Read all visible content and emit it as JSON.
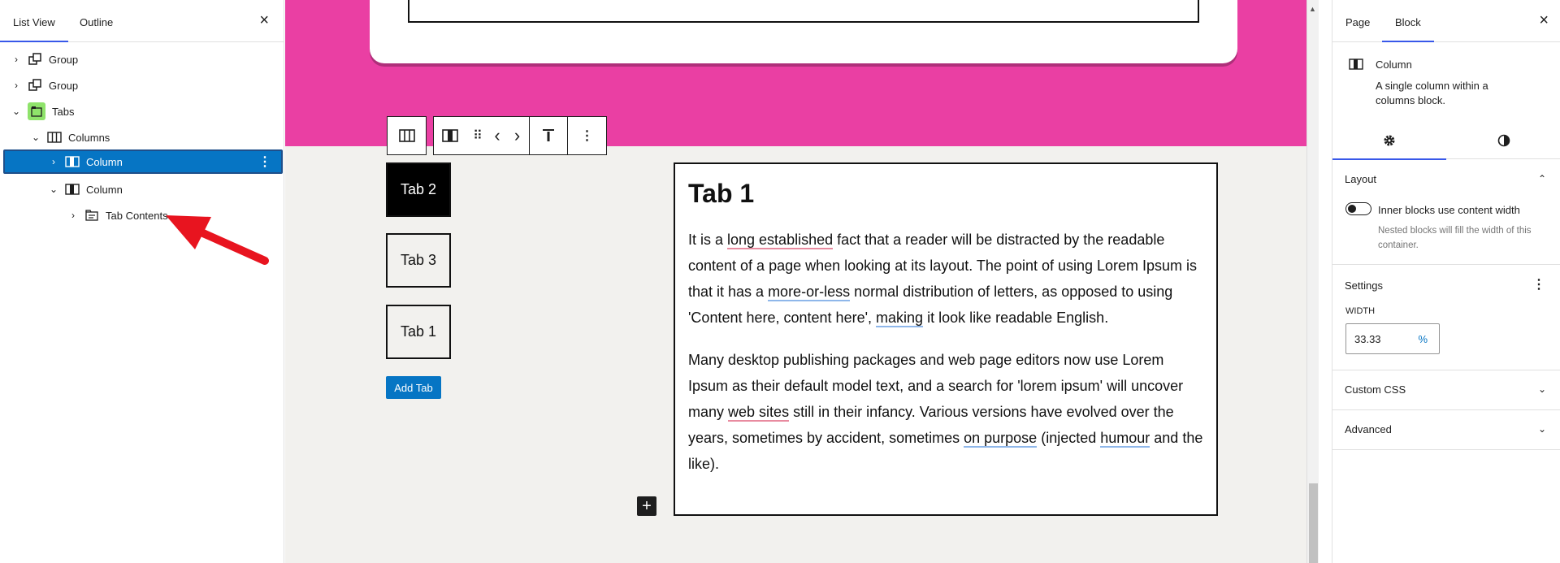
{
  "listview": {
    "tabs": [
      "List View",
      "Outline"
    ],
    "close": "×",
    "items": [
      {
        "label": "Group",
        "chevron": "›"
      },
      {
        "label": "Group",
        "chevron": "›"
      },
      {
        "label": "Tabs",
        "chevron": "⌄"
      },
      {
        "label": "Columns",
        "chevron": "⌄"
      },
      {
        "label": "Column",
        "chevron": "›"
      },
      {
        "label": "Column",
        "chevron": "⌄"
      },
      {
        "label": "Tab Contents",
        "chevron": "›"
      }
    ],
    "more": "⋮"
  },
  "canvas": {
    "tabs": [
      "Tab 2",
      "Tab 3",
      "Tab 1"
    ],
    "add_tab": "Add Tab",
    "plus": "+",
    "content": {
      "heading": "Tab 1",
      "p1": {
        "a": "It is a ",
        "b": "long established",
        "c": " fact that a reader will be distracted by the readable content of a page when looking at its layout. The point of using Lorem Ipsum is that it has a ",
        "d": "more-or-less",
        "e": " normal distribution of letters, as opposed to using 'Content here, content here', ",
        "f": "making",
        "g": " it look like readable English."
      },
      "p2": {
        "a": "Many desktop publishing packages and web page editors now use Lorem Ipsum as their default model text, and a search for 'lorem ipsum' will uncover many ",
        "b": "web sites",
        "c": " still in their infancy. Various versions have evolved over the years, sometimes by accident, sometimes ",
        "d": "on purpose",
        "e": " (injected ",
        "f": "humour",
        "g": " and the like)."
      }
    },
    "toolbar": {
      "move": "⠿",
      "prev": "‹",
      "next": "›",
      "more": "⋮"
    }
  },
  "inspector": {
    "tabs": [
      "Page",
      "Block"
    ],
    "close": "×",
    "block_title": "Column",
    "block_desc": "A single column within a columns block.",
    "layout_title": "Layout",
    "toggle_label": "Inner blocks use content width",
    "toggle_help": "Nested blocks will fill the width of this container.",
    "settings_title": "Settings",
    "width_label": "WIDTH",
    "width_value": "33.33",
    "width_unit": "%",
    "custom_css": "Custom CSS",
    "advanced": "Advanced",
    "chev_up": "⌃",
    "chev_down": "⌄",
    "more": "⋮"
  },
  "colors": {
    "accent": "#0675c4",
    "pink": "#ea3fa3",
    "selection": "#0675c4",
    "arrow": "#e8141f"
  }
}
